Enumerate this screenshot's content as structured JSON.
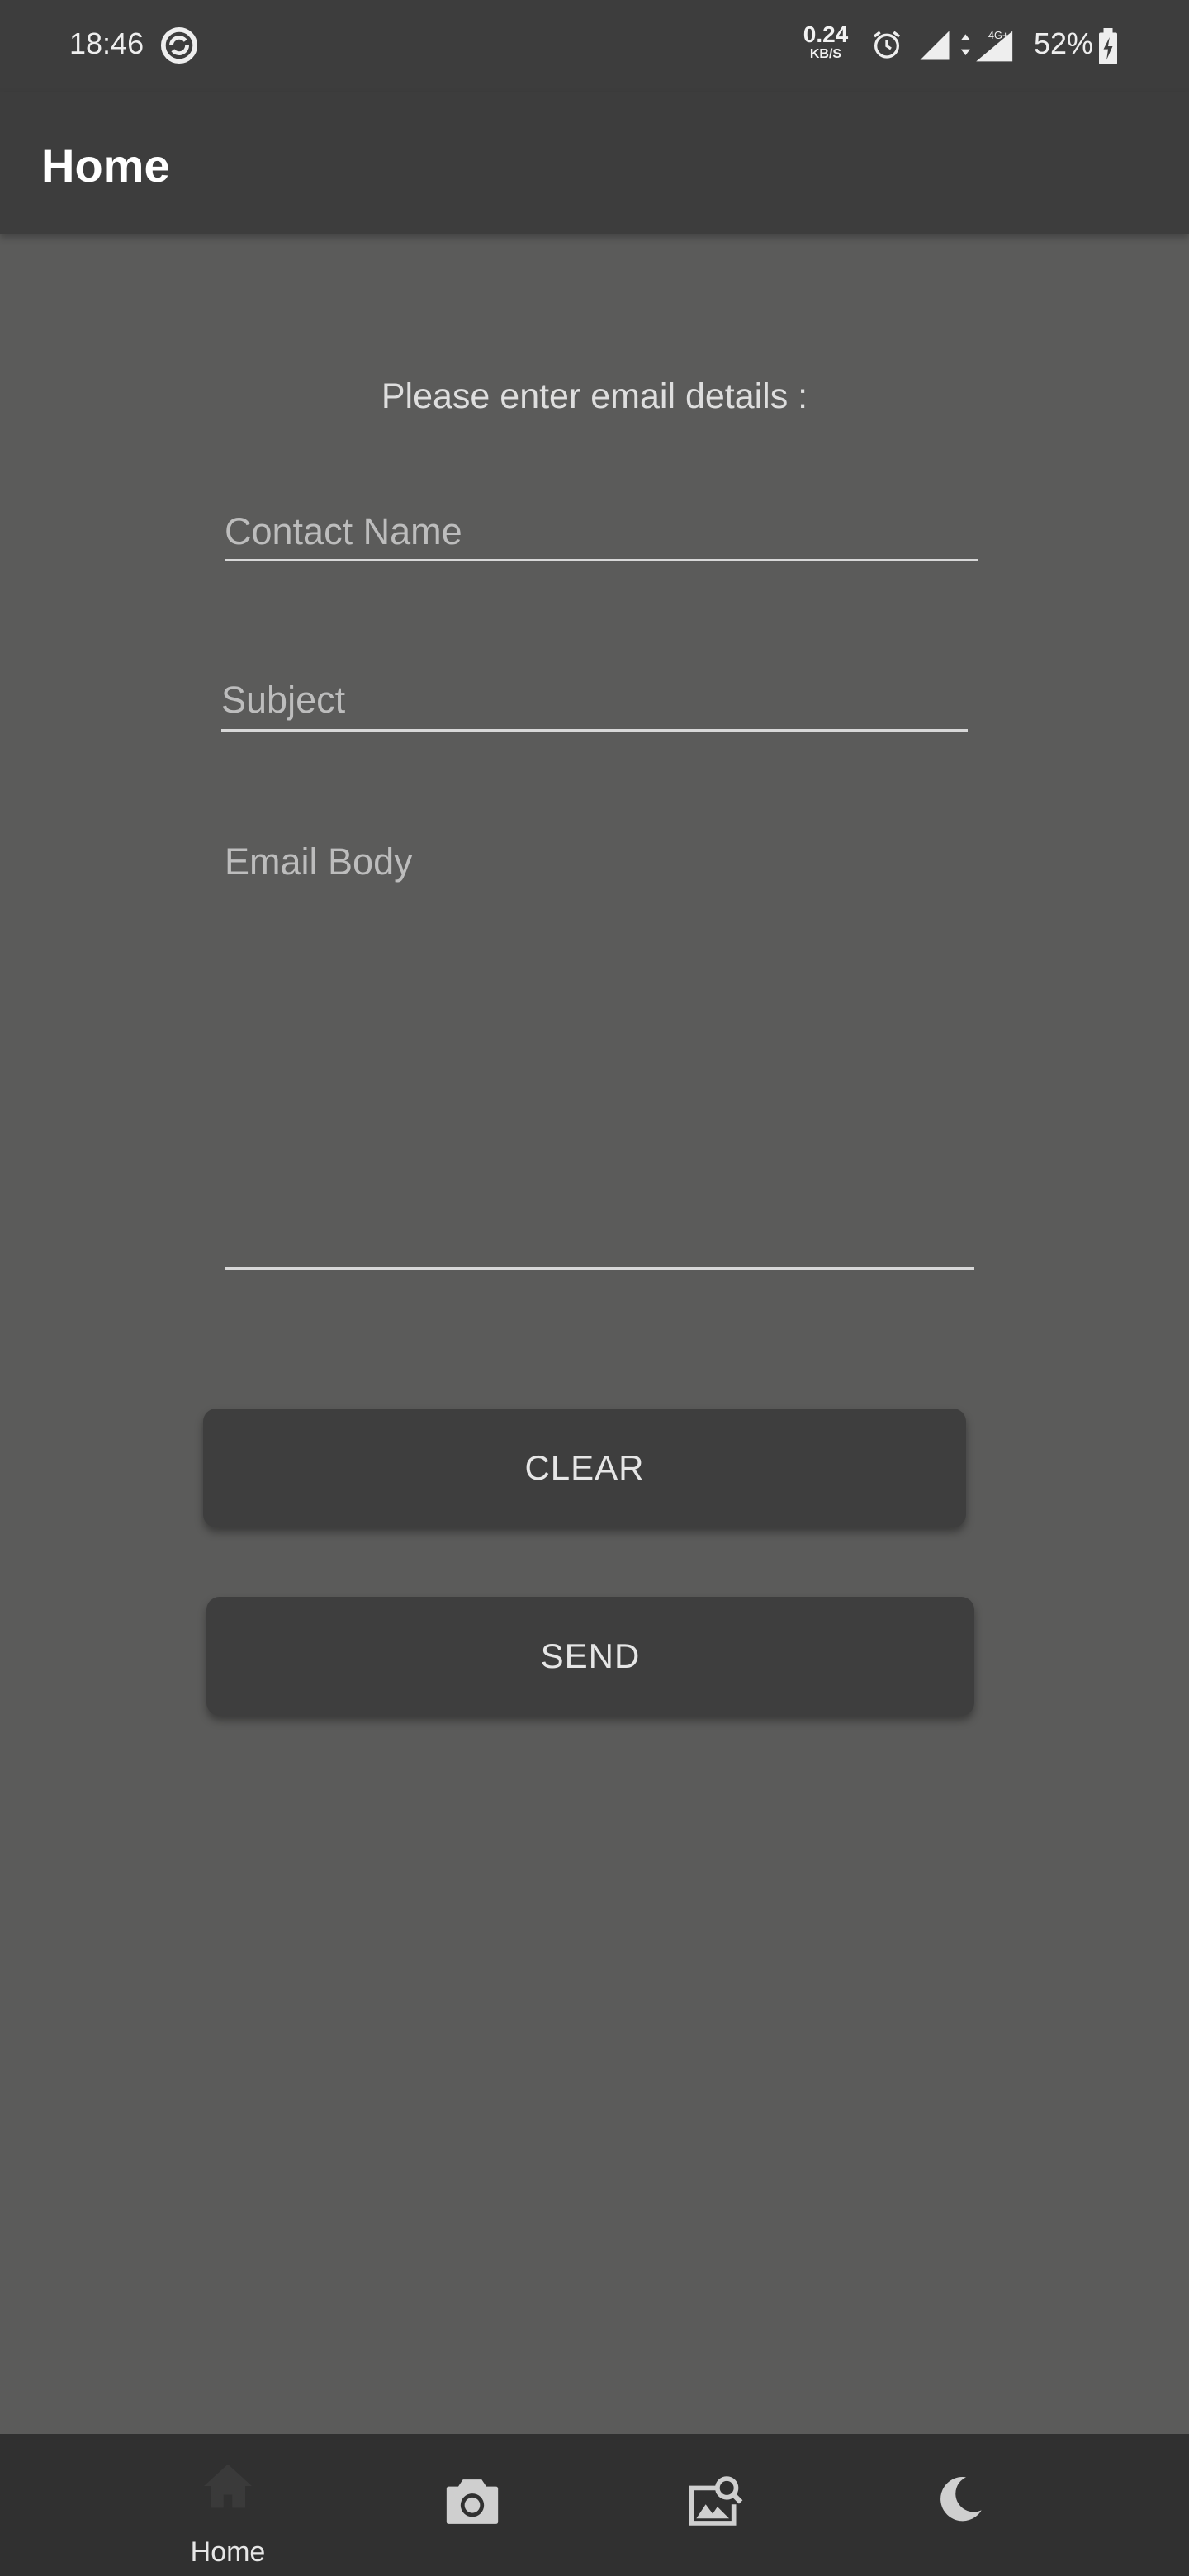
{
  "status_bar": {
    "time": "18:46",
    "network_speed_value": "0.24",
    "network_speed_unit": "KB/S",
    "battery_percent": "52%",
    "network_type": "4G+"
  },
  "app_bar": {
    "title": "Home"
  },
  "form": {
    "prompt": "Please enter email details :",
    "contact_name_placeholder": "Contact Name",
    "contact_name_value": "",
    "subject_placeholder": "Subject",
    "subject_value": "",
    "body_placeholder": "Email Body",
    "body_value": ""
  },
  "buttons": {
    "clear_label": "CLEAR",
    "send_label": "SEND"
  },
  "bottom_nav": {
    "items": [
      {
        "label": "Home",
        "icon": "home-icon",
        "selected": true
      },
      {
        "label": "",
        "icon": "camera-icon"
      },
      {
        "label": "",
        "icon": "image-search-icon"
      },
      {
        "label": "",
        "icon": "moon-icon"
      }
    ]
  },
  "colors": {
    "background": "#5b5b5a",
    "app_bar": "#3d3d3d",
    "button": "#3e3e3e",
    "bottom_nav": "#303030",
    "text": "#e6e6e6"
  }
}
